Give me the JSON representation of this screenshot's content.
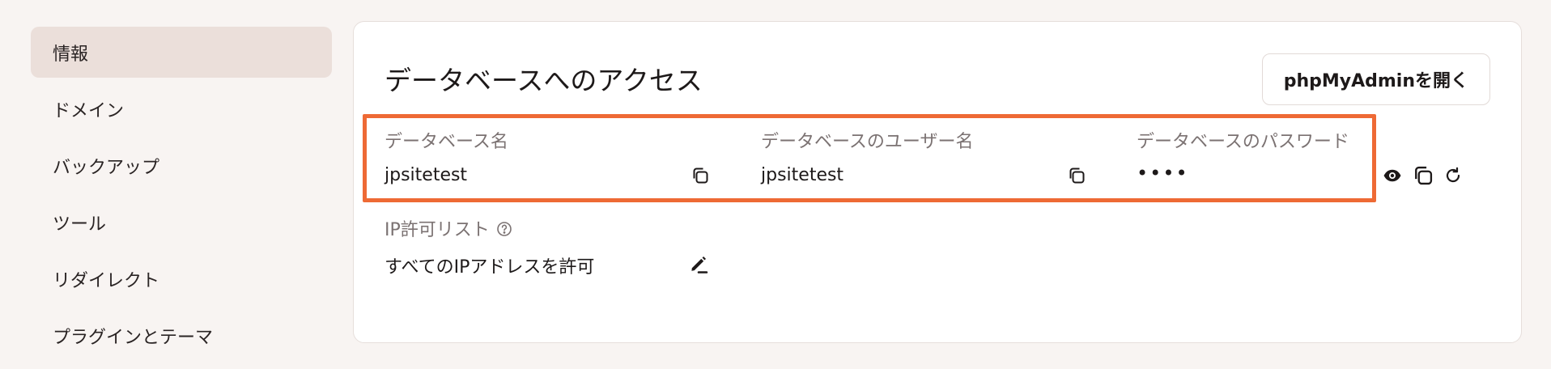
{
  "sidebar": {
    "items": [
      {
        "label": "情報",
        "active": true
      },
      {
        "label": "ドメイン"
      },
      {
        "label": "バックアップ"
      },
      {
        "label": "ツール"
      },
      {
        "label": "リダイレクト"
      },
      {
        "label": "プラグインとテーマ"
      }
    ]
  },
  "card": {
    "title": "データベースへのアクセス",
    "phpmyadmin_label": "phpMyAdminを開く",
    "db_name": {
      "label": "データベース名",
      "value": "jpsitetest"
    },
    "db_user": {
      "label": "データベースのユーザー名",
      "value": "jpsitetest"
    },
    "db_password": {
      "label": "データベースのパスワード",
      "value": "••••"
    },
    "ip_allowlist": {
      "label": "IP許可リスト",
      "value": "すべてのIPアドレスを許可"
    }
  },
  "colors": {
    "highlight": "#ee6a35",
    "active_bg": "#ebdfda",
    "page_bg": "#f8f4f2"
  },
  "icons": [
    "copy-icon",
    "eye-icon",
    "refresh-icon",
    "edit-icon",
    "help-icon"
  ]
}
